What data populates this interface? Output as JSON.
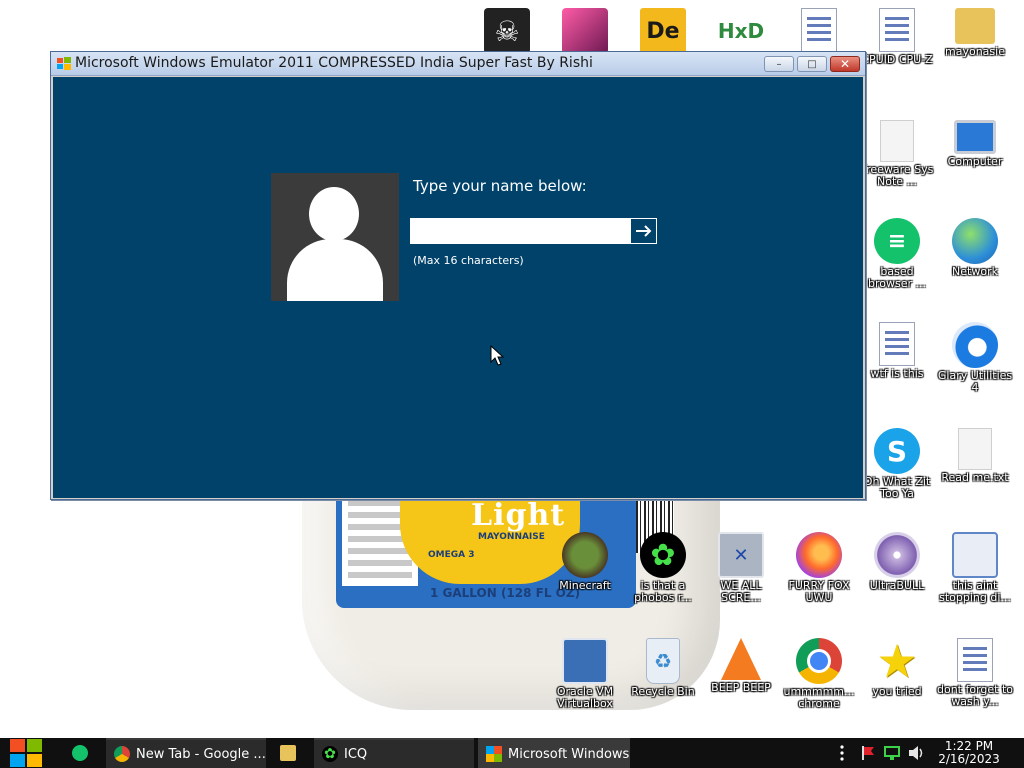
{
  "window": {
    "title": "Microsoft Windows Emulator 2011 COMPRESSED India Super Fast By Rishi",
    "minimize_label": "–",
    "maximize_label": "□",
    "close_label": "✕"
  },
  "login": {
    "prompt": "Type your name below:",
    "input_value": "",
    "input_placeholder": "",
    "hint": "(Max 16 characters)",
    "submit_icon": "arrow-right-icon"
  },
  "wallpaper": {
    "label_word": "Light",
    "label_sub": "MAYONNAISE",
    "label_omega": "OMEGA 3",
    "bottom_text": "1 GALLON (128 FL OZ)"
  },
  "desktop_icons": [
    {
      "label": "",
      "icon": "skull-icon"
    },
    {
      "label": "",
      "icon": "pink-app-icon"
    },
    {
      "label": "",
      "icon": "de-app-icon"
    },
    {
      "label": "",
      "icon": "hxd-icon"
    },
    {
      "label": "",
      "icon": "document-icon"
    },
    {
      "label": "CPUID CPU-Z",
      "icon": "document-icon"
    },
    {
      "label": "mayonasie",
      "icon": "user-folder-icon"
    },
    {
      "label": "Freeware Sys Note ...",
      "icon": "blank-document-icon"
    },
    {
      "label": "Computer",
      "icon": "computer-icon"
    },
    {
      "label": "based browser ...",
      "icon": "green-chat-icon"
    },
    {
      "label": "Network",
      "icon": "network-icon"
    },
    {
      "label": "wtf is this",
      "icon": "document-icon"
    },
    {
      "label": "Glary Utilities 4",
      "icon": "glary-icon"
    },
    {
      "label": "Oh What Zit Too Ya",
      "icon": "skype-icon"
    },
    {
      "label": "Read me.txt",
      "icon": "text-file-icon"
    },
    {
      "label": "Minecraft",
      "icon": "minecraft-icon"
    },
    {
      "label": "is that a phobos r...",
      "icon": "icq-icon"
    },
    {
      "label": "WE ALL SCRE...",
      "icon": "computer-icon"
    },
    {
      "label": "FURRY FOX UWU",
      "icon": "firefox-icon"
    },
    {
      "label": "UltraBULL",
      "icon": "disc-icon"
    },
    {
      "label": "this aint stopping di...",
      "icon": "search-computer-icon"
    },
    {
      "label": "Oracle VM Virtualbox",
      "icon": "virtualbox-icon"
    },
    {
      "label": "Recycle Bin",
      "icon": "recycle-bin-icon"
    },
    {
      "label": "BEEP BEEP",
      "icon": "vlc-icon"
    },
    {
      "label": "ummmmm... chrome",
      "icon": "chrome-icon"
    },
    {
      "label": "you tried",
      "icon": "star-icon"
    },
    {
      "label": "dont forget to wash y...",
      "icon": "document-icon"
    }
  ],
  "taskbar": {
    "items": [
      {
        "label": "",
        "icon": "green-chat-icon"
      },
      {
        "label": "New Tab - Google ...",
        "icon": "chrome-icon"
      },
      {
        "label": "",
        "icon": "folder-icon"
      },
      {
        "label": "ICQ",
        "icon": "icq-icon"
      },
      {
        "label": "Microsoft Windows ...",
        "icon": "emulator-icon"
      }
    ],
    "time": "1:22 PM",
    "date": "2/16/2023"
  }
}
